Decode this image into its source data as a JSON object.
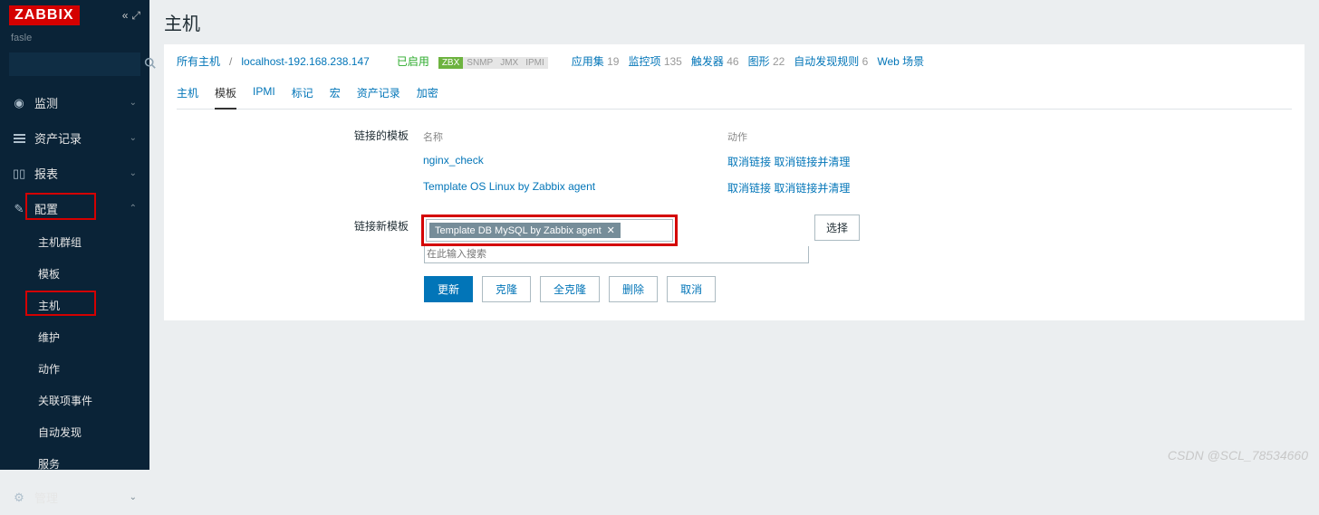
{
  "logo": "ZABBIX",
  "username": "fasle",
  "search": {
    "placeholder": ""
  },
  "sidebar": {
    "items": [
      {
        "label": "监测",
        "icon": "◎"
      },
      {
        "label": "资产记录",
        "icon": "≡"
      },
      {
        "label": "报表",
        "icon": "▥"
      },
      {
        "label": "配置",
        "icon": "⚙"
      },
      {
        "label": "管理",
        "icon": "⚙"
      }
    ],
    "config_children": [
      {
        "label": "主机群组"
      },
      {
        "label": "模板"
      },
      {
        "label": "主机"
      },
      {
        "label": "维护"
      },
      {
        "label": "动作"
      },
      {
        "label": "关联项事件"
      },
      {
        "label": "自动发现"
      },
      {
        "label": "服务"
      }
    ]
  },
  "page_title": "主机",
  "breadcrumb": {
    "all_hosts": "所有主机",
    "host": "localhost-192.168.238.147",
    "enabled": "已启用",
    "zbx": "ZBX",
    "snmp": "SNMP",
    "jmx": "JMX",
    "ipmi": "IPMI",
    "links": [
      {
        "label": "应用集",
        "count": "19"
      },
      {
        "label": "监控项",
        "count": "135"
      },
      {
        "label": "触发器",
        "count": "46"
      },
      {
        "label": "图形",
        "count": "22"
      },
      {
        "label": "自动发现规则",
        "count": "6"
      },
      {
        "label": "Web 场景",
        "count": ""
      }
    ]
  },
  "tabs": [
    {
      "label": "主机"
    },
    {
      "label": "模板"
    },
    {
      "label": "IPMI"
    },
    {
      "label": "标记"
    },
    {
      "label": "宏"
    },
    {
      "label": "资产记录"
    },
    {
      "label": "加密"
    }
  ],
  "linked": {
    "label": "链接的模板",
    "col_name": "名称",
    "col_action": "动作",
    "rows": [
      {
        "name": "nginx_check",
        "unlink": "取消链接",
        "unlink_clear": "取消链接并清理"
      },
      {
        "name": "Template OS Linux by Zabbix agent",
        "unlink": "取消链接",
        "unlink_clear": "取消链接并清理"
      }
    ]
  },
  "new_link": {
    "label": "链接新模板",
    "tag": "Template DB MySQL by Zabbix agent",
    "placeholder": "在此输入搜索",
    "select_btn": "选择"
  },
  "buttons": {
    "update": "更新",
    "clone": "克隆",
    "full_clone": "全克隆",
    "delete": "删除",
    "cancel": "取消"
  },
  "watermark": "CSDN @SCL_78534660"
}
